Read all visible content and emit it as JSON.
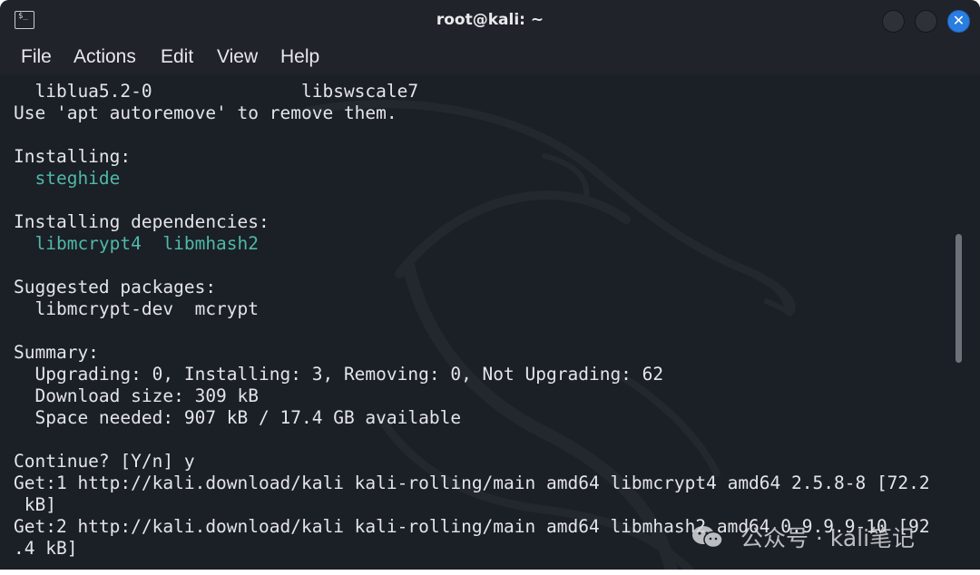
{
  "window": {
    "title": "root@kali: ~",
    "close_glyph": "✕",
    "terminal_icon_glyph": "$_"
  },
  "menu": [
    "File",
    "Actions",
    "Edit",
    "View",
    "Help"
  ],
  "terminal": {
    "lines": [
      {
        "text": "  liblua5.2-0              libswscale7",
        "style": "normal"
      },
      {
        "text": "Use 'apt autoremove' to remove them.",
        "style": "normal"
      },
      {
        "text": "",
        "style": "normal"
      },
      {
        "text": "Installing:",
        "style": "normal"
      },
      {
        "text": "  steghide",
        "style": "cyan"
      },
      {
        "text": "",
        "style": "normal"
      },
      {
        "text": "Installing dependencies:",
        "style": "normal"
      },
      {
        "text": "  libmcrypt4  libmhash2",
        "style": "cyan"
      },
      {
        "text": "",
        "style": "normal"
      },
      {
        "text": "Suggested packages:",
        "style": "normal"
      },
      {
        "text": "  libmcrypt-dev  mcrypt",
        "style": "normal"
      },
      {
        "text": "",
        "style": "normal"
      },
      {
        "text": "Summary:",
        "style": "normal"
      },
      {
        "text": "  Upgrading: 0, Installing: 3, Removing: 0, Not Upgrading: 62",
        "style": "normal"
      },
      {
        "text": "  Download size: 309 kB",
        "style": "normal"
      },
      {
        "text": "  Space needed: 907 kB / 17.4 GB available",
        "style": "normal"
      },
      {
        "text": "",
        "style": "normal"
      },
      {
        "text": "Continue? [Y/n] y",
        "style": "normal"
      },
      {
        "text": "Get:1 http://kali.download/kali kali-rolling/main amd64 libmcrypt4 amd64 2.5.8-8 [72.2",
        "style": "normal"
      },
      {
        "text": " kB]",
        "style": "normal"
      },
      {
        "text": "Get:2 http://kali.download/kali kali-rolling/main amd64 libmhash2 amd64 0.9.9.9-10 [92",
        "style": "normal"
      },
      {
        "text": ".4 kB]",
        "style": "normal"
      }
    ]
  },
  "watermark": {
    "text": "公众号 · kali笔记"
  },
  "colors": {
    "background": "#1b1f26",
    "titlebar": "#20232a",
    "text": "#e3e5e8",
    "package_highlight": "#4fb9a9",
    "close_button": "#2a7de1"
  }
}
